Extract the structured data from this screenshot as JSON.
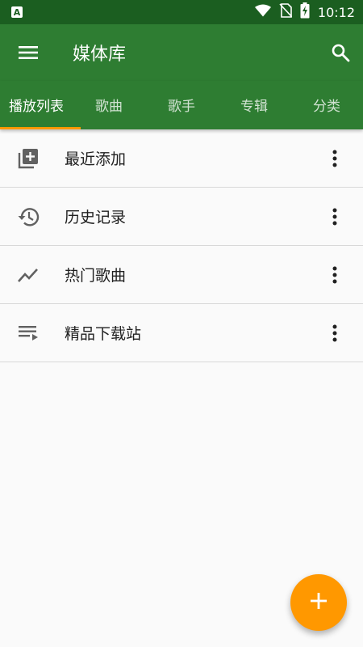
{
  "status_bar": {
    "time": "10:12",
    "notification_icon": "A",
    "icons": [
      "wifi-icon",
      "no-sim-icon",
      "battery-charging-icon"
    ]
  },
  "app_bar": {
    "title": "媒体库",
    "left_icon": "menu-icon",
    "right_icon": "search-icon"
  },
  "tabs": [
    {
      "label": "播放列表",
      "active": true
    },
    {
      "label": "歌曲",
      "active": false
    },
    {
      "label": "歌手",
      "active": false
    },
    {
      "label": "专辑",
      "active": false
    },
    {
      "label": "分类",
      "active": false
    }
  ],
  "list": {
    "items": [
      {
        "label": "最近添加",
        "icon": "playlist-add-icon"
      },
      {
        "label": "历史记录",
        "icon": "history-icon"
      },
      {
        "label": "热门歌曲",
        "icon": "trending-icon"
      },
      {
        "label": "精品下载站",
        "icon": "queue-music-icon"
      }
    ]
  },
  "fab": {
    "icon": "add-icon",
    "label": "+"
  },
  "colors": {
    "status_bar": "#1b5e20",
    "primary": "#2e7d32",
    "accent": "#ff9800",
    "background": "#fafafa",
    "icon_gray": "#616161"
  }
}
